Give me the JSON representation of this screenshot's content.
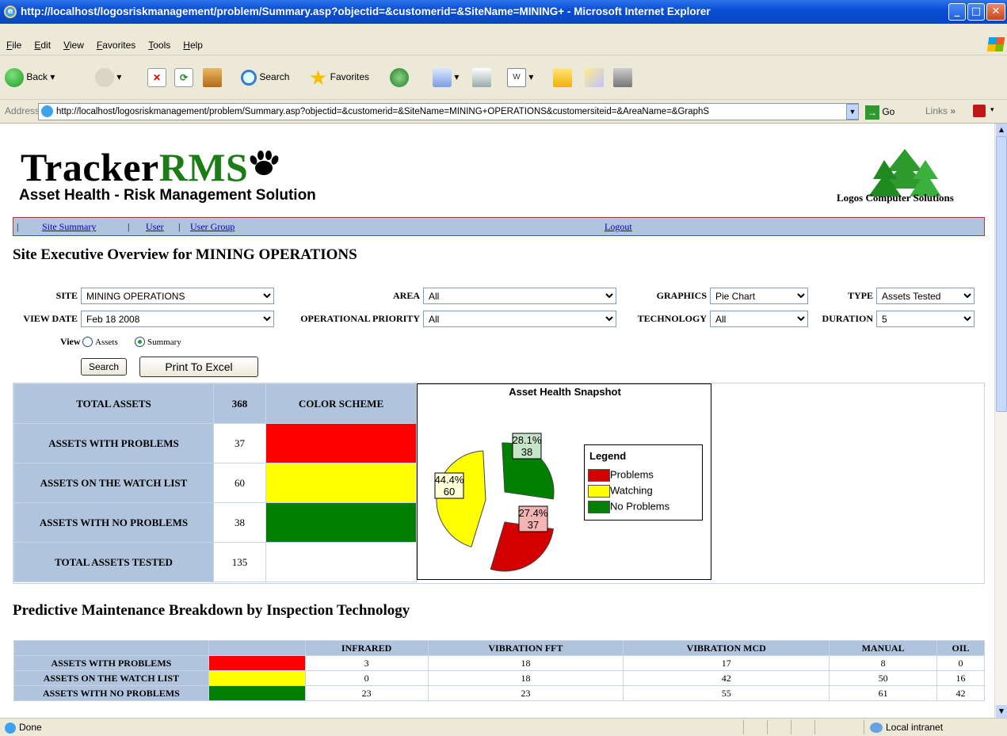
{
  "window": {
    "title": "http://localhost/logosriskmanagement/problem/Summary.asp?objectid=&customerid=&SiteName=MINING+ - Microsoft Internet Explorer"
  },
  "menu": [
    "File",
    "Edit",
    "View",
    "Favorites",
    "Tools",
    "Help"
  ],
  "toolbar": {
    "back": "Back",
    "search": "Search",
    "favorites": "Favorites"
  },
  "address": {
    "label": "Address",
    "url": "http://localhost/logosriskmanagement/problem/Summary.asp?objectid=&customerid=&SiteName=MINING+OPERATIONS&customersiteid=&AreaName=&GraphS",
    "go": "Go",
    "links": "Links"
  },
  "header": {
    "logo_black": "Tracker",
    "logo_green": "RMS",
    "tagline": "Asset Health - Risk Management Solution",
    "company": "Logos Computer Solutions"
  },
  "nav": {
    "site_summary": "Site Summary",
    "user": "User",
    "user_group": "User Group",
    "logout": "Logout",
    "sep": "|"
  },
  "page_title": "Site Executive Overview for MINING OPERATIONS",
  "filters": {
    "site_label": "SITE",
    "site_value": "MINING OPERATIONS",
    "area_label": "AREA",
    "area_value": "All",
    "graphics_label": "GRAPHICS",
    "graphics_value": "Pie Chart",
    "type_label": "TYPE",
    "type_value": "Assets Tested",
    "viewdate_label": "VIEW DATE",
    "viewdate_value": "Feb 18 2008",
    "priority_label": "OPERATIONAL PRIORITY",
    "priority_value": "All",
    "technology_label": "TECHNOLOGY",
    "technology_value": "All",
    "duration_label": "DURATION",
    "duration_value": "5",
    "view_label": "View",
    "view_assets": "Assets",
    "view_summary": "Summary",
    "search_btn": "Search",
    "excel_btn": "Print To Excel"
  },
  "summary": {
    "total_assets_label": "TOTAL ASSETS",
    "total_assets": "368",
    "color_scheme": "COLOR SCHEME",
    "rows": [
      {
        "label": "ASSETS WITH PROBLEMS",
        "value": "37",
        "color": "#ff0000"
      },
      {
        "label": "ASSETS ON THE WATCH LIST",
        "value": "60",
        "color": "#ffff00"
      },
      {
        "label": "ASSETS WITH NO PROBLEMS",
        "value": "38",
        "color": "#008000"
      }
    ],
    "total_tested_label": "TOTAL ASSETS TESTED",
    "total_tested": "135"
  },
  "chart_data": {
    "type": "pie",
    "title": "Asset Health Snapshot",
    "legend_title": "Legend",
    "legend_position": "right",
    "slices": [
      {
        "name": "Problems",
        "value": 37,
        "percent": "27.4%",
        "color": "#d40000",
        "label_bg": "#f4b4b4"
      },
      {
        "name": "Watching",
        "value": 60,
        "percent": "44.4%",
        "color": "#ffff00",
        "label_bg": "#ffffd8"
      },
      {
        "name": "No Problems",
        "value": 38,
        "percent": "28.1%",
        "color": "#008000",
        "label_bg": "#c8e4c8"
      }
    ]
  },
  "breakdown": {
    "title": "Predictive Maintenance Breakdown by Inspection Technology",
    "columns": [
      "INFRARED",
      "VIBRATION FFT",
      "VIBRATION MCD",
      "MANUAL",
      "OIL"
    ],
    "rows": [
      {
        "label": "ASSETS WITH PROBLEMS",
        "color": "#ff0000",
        "values": [
          "3",
          "18",
          "17",
          "8",
          "0"
        ]
      },
      {
        "label": "ASSETS ON THE WATCH LIST",
        "color": "#ffff00",
        "values": [
          "0",
          "18",
          "42",
          "50",
          "16"
        ]
      },
      {
        "label": "ASSETS WITH NO PROBLEMS",
        "color": "#008000",
        "values": [
          "23",
          "23",
          "55",
          "61",
          "42"
        ]
      }
    ]
  },
  "status": {
    "left": "Done",
    "zone": "Local intranet"
  }
}
